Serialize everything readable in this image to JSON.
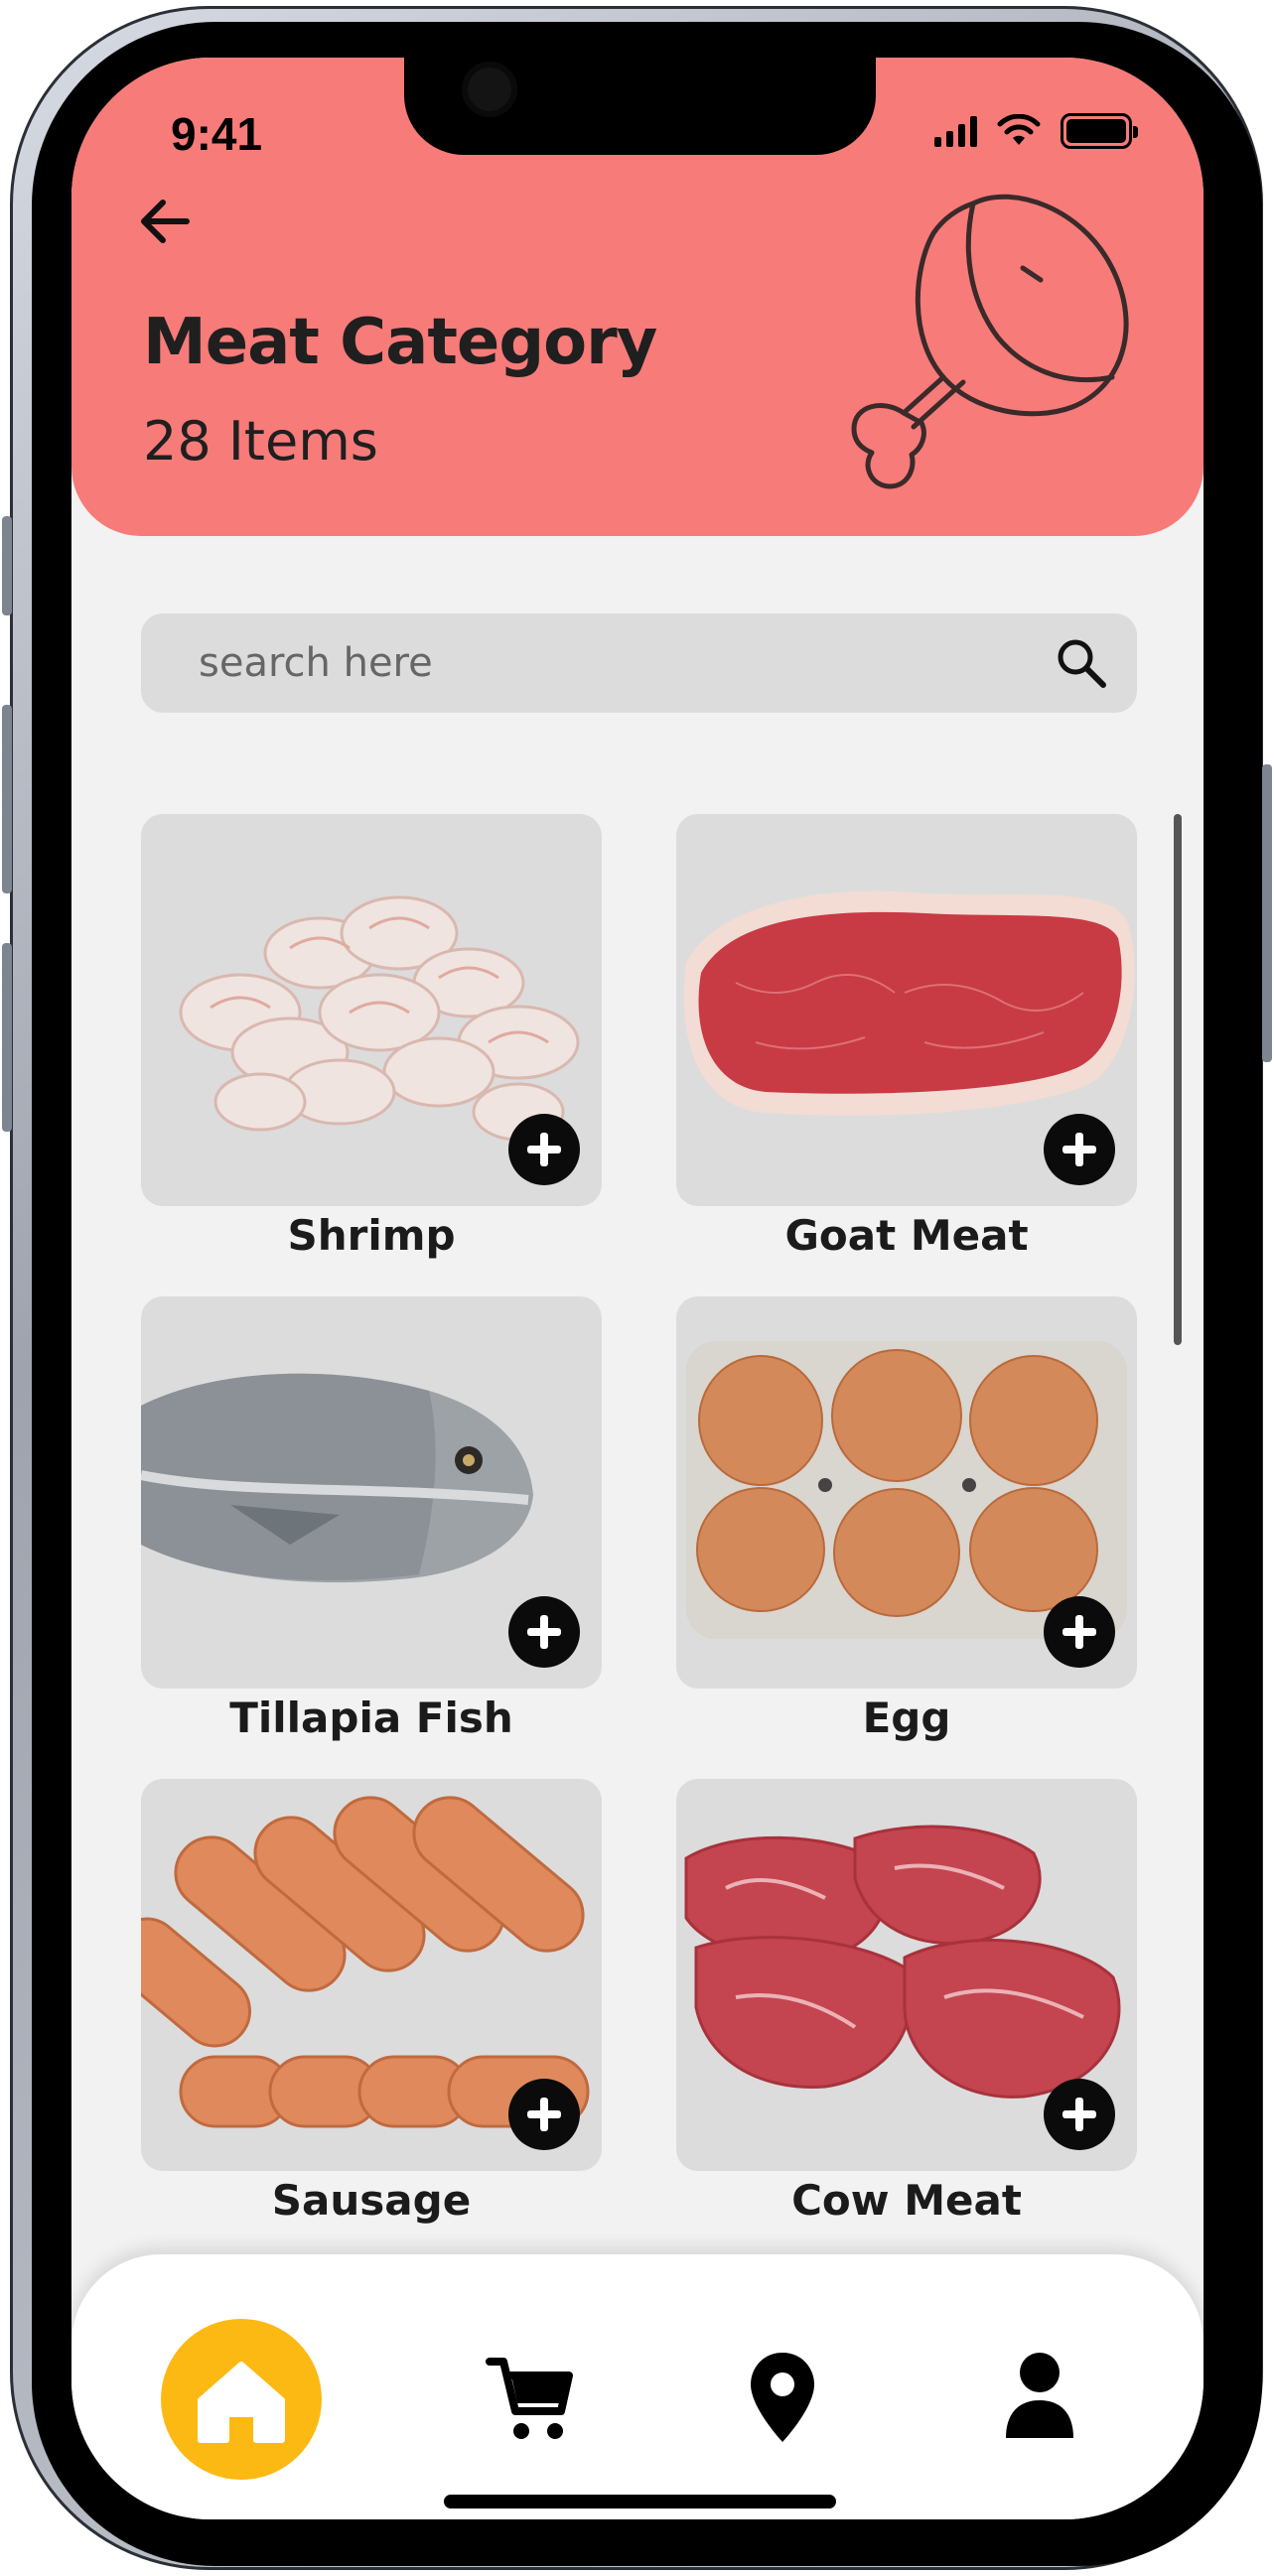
{
  "status_bar": {
    "time": "9:41"
  },
  "header": {
    "title": "Meat Category",
    "subtitle": "28 Items",
    "back_icon": "arrow-left-icon",
    "illustration_icon": "meat-leg-icon",
    "background_color": "#f77b79"
  },
  "search": {
    "placeholder": "search here",
    "value": "",
    "icon": "search-icon"
  },
  "products": [
    {
      "label": "Shrimp",
      "image": "shrimp"
    },
    {
      "label": "Goat Meat",
      "image": "steak"
    },
    {
      "label": "Tillapia Fish",
      "image": "fish"
    },
    {
      "label": "Egg",
      "image": "eggs"
    },
    {
      "label": "Sausage",
      "image": "sausage"
    },
    {
      "label": "Cow Meat",
      "image": "beef"
    }
  ],
  "bottom_nav": {
    "items": [
      {
        "icon": "home-icon",
        "active": true
      },
      {
        "icon": "cart-icon",
        "active": false
      },
      {
        "icon": "location-pin-icon",
        "active": false
      },
      {
        "icon": "user-icon",
        "active": false
      }
    ],
    "active_color": "#fdb913"
  }
}
